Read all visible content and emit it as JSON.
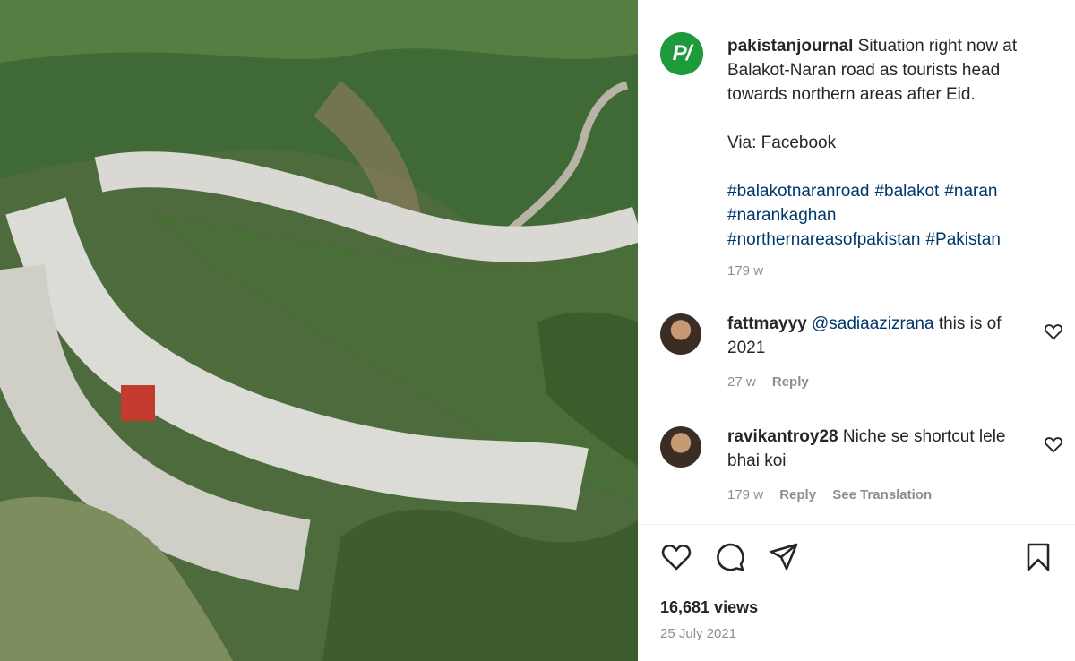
{
  "post": {
    "username": "pakistanjournal",
    "caption": "Situation right now at Balakot-Naran road as tourists head towards northern areas after Eid.",
    "via": "Via: Facebook",
    "hashtags": [
      "#balakotnaranroad",
      "#balakot",
      "#naran",
      "#narankaghan",
      "#northernareasofpakistan",
      "#Pakistan"
    ],
    "age": "179 w",
    "avatar_text": "P/",
    "brand_color": "#1d9a3a"
  },
  "comments": [
    {
      "username": "fattmayyy",
      "mention": "@sadiaazizrana",
      "text": "this is of 2021",
      "age": "27 w",
      "reply_label": "Reply"
    },
    {
      "username": "ravikantroy28",
      "text": "Niche se shortcut lele bhai koi",
      "age": "179 w",
      "reply_label": "Reply",
      "translation_label": "See Translation"
    }
  ],
  "stats": {
    "views": "16,681 views",
    "date": "25 July 2021"
  },
  "icons": {
    "like": "heart-icon",
    "comment": "comment-icon",
    "share": "send-icon",
    "save": "bookmark-icon"
  }
}
